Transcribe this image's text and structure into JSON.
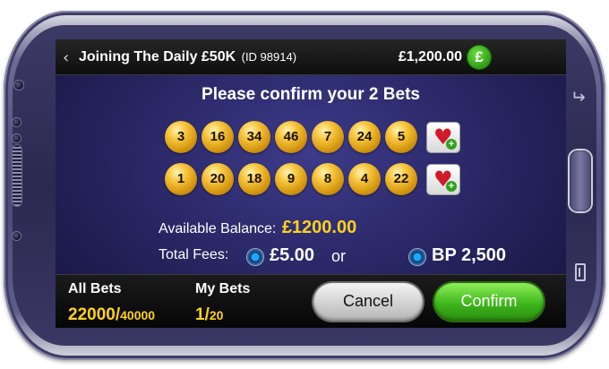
{
  "header": {
    "back_glyph": "‹",
    "event_title": "Joining The Daily £50K",
    "event_id": "(ID 98914)",
    "balance": "£1,200.00",
    "currency_icon": "£",
    "currency_icon_name": "pound-cash-icon"
  },
  "dialog": {
    "heading": "Please confirm your 2 Bets",
    "bets": [
      {
        "numbers": [
          "3",
          "16",
          "34",
          "46",
          "7",
          "24",
          "5"
        ]
      },
      {
        "numbers": [
          "1",
          "20",
          "18",
          "9",
          "8",
          "4",
          "22"
        ]
      }
    ],
    "favourite_icon": "heart-plus-icon",
    "available_balance_label": "Available Balance:",
    "available_balance_value": "£1200.00",
    "total_fees_label": "Total Fees:",
    "fee_cash": "£5.00",
    "fee_or": "or",
    "fee_bp": "BP 2,500"
  },
  "footer": {
    "all_bets_label": "All Bets",
    "all_bets_current": "22000/",
    "all_bets_total": "40000",
    "my_bets_label": "My Bets",
    "my_bets_current": "1/",
    "my_bets_total": "20",
    "cancel_label": "Cancel",
    "confirm_label": "Confirm"
  },
  "colors": {
    "accent_yellow": "#ffd21e",
    "confirm_green": "#3eb61c",
    "ball_gold": "#f7c53e",
    "screen_bg": "#26245f"
  }
}
